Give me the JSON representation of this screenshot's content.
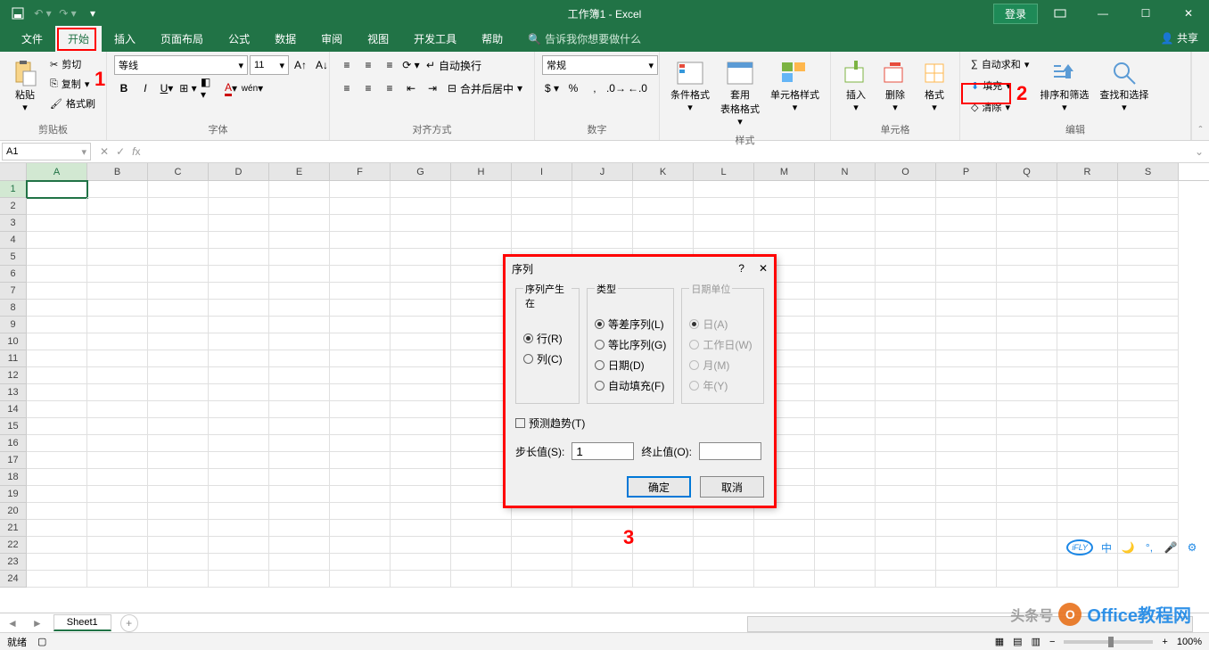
{
  "title": "工作簿1 - Excel",
  "login": "登录",
  "tabs": [
    "文件",
    "开始",
    "插入",
    "页面布局",
    "公式",
    "数据",
    "审阅",
    "视图",
    "开发工具",
    "帮助"
  ],
  "search_hint": "告诉我你想要做什么",
  "share": "共享",
  "ribbon": {
    "clipboard": {
      "label": "剪贴板",
      "paste": "粘贴",
      "cut": "剪切",
      "copy": "复制",
      "format_painter": "格式刷"
    },
    "font": {
      "label": "字体",
      "name": "等线",
      "size": "11"
    },
    "align": {
      "label": "对齐方式",
      "wrap": "自动换行",
      "merge": "合并后居中"
    },
    "number": {
      "label": "数字",
      "format": "常规"
    },
    "styles": {
      "label": "样式",
      "cond": "条件格式",
      "table": "套用\n表格格式",
      "cell": "单元格样式"
    },
    "cells": {
      "label": "单元格",
      "insert": "插入",
      "delete": "删除",
      "format": "格式"
    },
    "editing": {
      "label": "编辑",
      "autosum": "自动求和",
      "fill": "填充",
      "clear": "清除",
      "sort": "排序和筛选",
      "find": "查找和选择"
    }
  },
  "name_box": "A1",
  "columns": [
    "A",
    "B",
    "C",
    "D",
    "E",
    "F",
    "G",
    "H",
    "I",
    "J",
    "K",
    "L",
    "M",
    "N",
    "O",
    "P",
    "Q",
    "R",
    "S"
  ],
  "dialog": {
    "title": "序列",
    "group1": "序列产生在",
    "row": "行(R)",
    "col": "列(C)",
    "group2": "类型",
    "linear": "等差序列(L)",
    "growth": "等比序列(G)",
    "date": "日期(D)",
    "autofill": "自动填充(F)",
    "group3": "日期单位",
    "day": "日(A)",
    "weekday": "工作日(W)",
    "month": "月(M)",
    "year": "年(Y)",
    "trend": "预测趋势(T)",
    "step_label": "步长值(S):",
    "step_value": "1",
    "stop_label": "终止值(O):",
    "ok": "确定",
    "cancel": "取消"
  },
  "sheet": "Sheet1",
  "status": "就绪",
  "zoom": "100%",
  "annotations": {
    "a1": "1",
    "a2": "2",
    "a3": "3"
  },
  "watermark": {
    "main": "Office教程网",
    "sub": "头条号"
  }
}
